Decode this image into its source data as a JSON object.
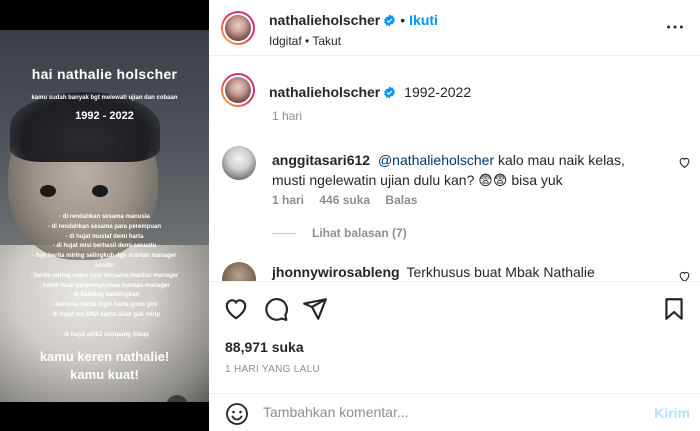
{
  "post": {
    "story": {
      "title": "hai nathalie holscher",
      "subtitle": "kamu sudah banyak bgt melewati ujian dan cobaan",
      "years": "1992 - 2022",
      "list": [
        "- di rendahkan sesama manusia",
        "- di rendahkan sesama para perempuan",
        "- di hujat muslaf demi harta",
        "- di hujat misi berhasil demi sesuatu",
        "- byk berita miring selingkuh dgn mantan manager",
        "sendiri",
        "- berita miring video syur bersama mantan manager",
        "- hamil hasil perselingkuhan mantan manager",
        "- di banding bandingkan",
        "- bercerai karna ingin harta gono gini",
        "- di hujat tes DNA karna anak gak mirip",
        "",
        "- di hujat adik2 numpang hidup"
      ],
      "closing": [
        "kamu keren nathalie!",
        "kamu kuat!"
      ]
    },
    "header": {
      "username": "nathalieholscher",
      "follow_label": "Ikuti",
      "separator": "•",
      "audio": "Idgitaf • Takut"
    },
    "caption": {
      "username": "nathalieholscher",
      "text": "1992-2022",
      "time": "1 hari"
    },
    "comments": [
      {
        "username": "anggitasari612",
        "mention": "@nathalieholscher",
        "text_line1": " kalo mau naik kelas,",
        "text_line2": "musti ngelewatin ujian dulu kan? 😨😨 bisa yuk",
        "time": "1 hari",
        "likes": "446 suka",
        "reply_label": "Balas",
        "view_replies": "Lihat balasan (7)"
      },
      {
        "username": "jhonnywirosableng",
        "text": "Terkhusus buat Mbak Nathalie"
      }
    ],
    "likes": "88,971 suka",
    "posted_ago": "1 HARI YANG LALU",
    "add_comment": {
      "placeholder": "Tambahkan komentar...",
      "send_label": "Kirim"
    },
    "colors": {
      "link_blue": "#0095f6",
      "mention_blue": "#00376b",
      "muted_gray": "#8e8e8e",
      "send_disabled": "#b2dffc"
    },
    "icons": [
      "verified-badge-icon",
      "more-options-icon",
      "heart-icon",
      "comment-icon",
      "share-icon",
      "bookmark-icon",
      "emoji-icon",
      "mute-icon"
    ]
  }
}
